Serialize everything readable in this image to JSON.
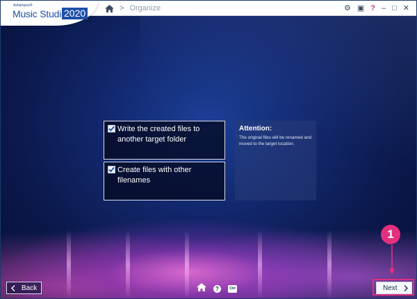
{
  "app": {
    "brand_small": "Ashampoo®",
    "brand_name": "Music Studio",
    "brand_year": "2020"
  },
  "breadcrumb": {
    "home_icon": "home-icon",
    "separator": ">",
    "page": "Organize"
  },
  "window_controls": {
    "settings": "⚙",
    "profile": "▣",
    "help": "?",
    "minimize": "–",
    "maximize": "□",
    "close": "✕"
  },
  "options": [
    {
      "label": "Write the created files to another target folder",
      "checked": true
    },
    {
      "label": "Create files with other filenames",
      "checked": true
    }
  ],
  "attention": {
    "title": "Attention:",
    "text": "The original files will be renamed and moved to the target location."
  },
  "footer": {
    "back_label": "Back",
    "next_label": "Next",
    "help_label": "?",
    "ctrl_label": "Ctrl"
  },
  "annotation": {
    "step": "1"
  },
  "colors": {
    "accent": "#1d4fa8",
    "highlight": "#e2307e",
    "background": "#12286e"
  }
}
